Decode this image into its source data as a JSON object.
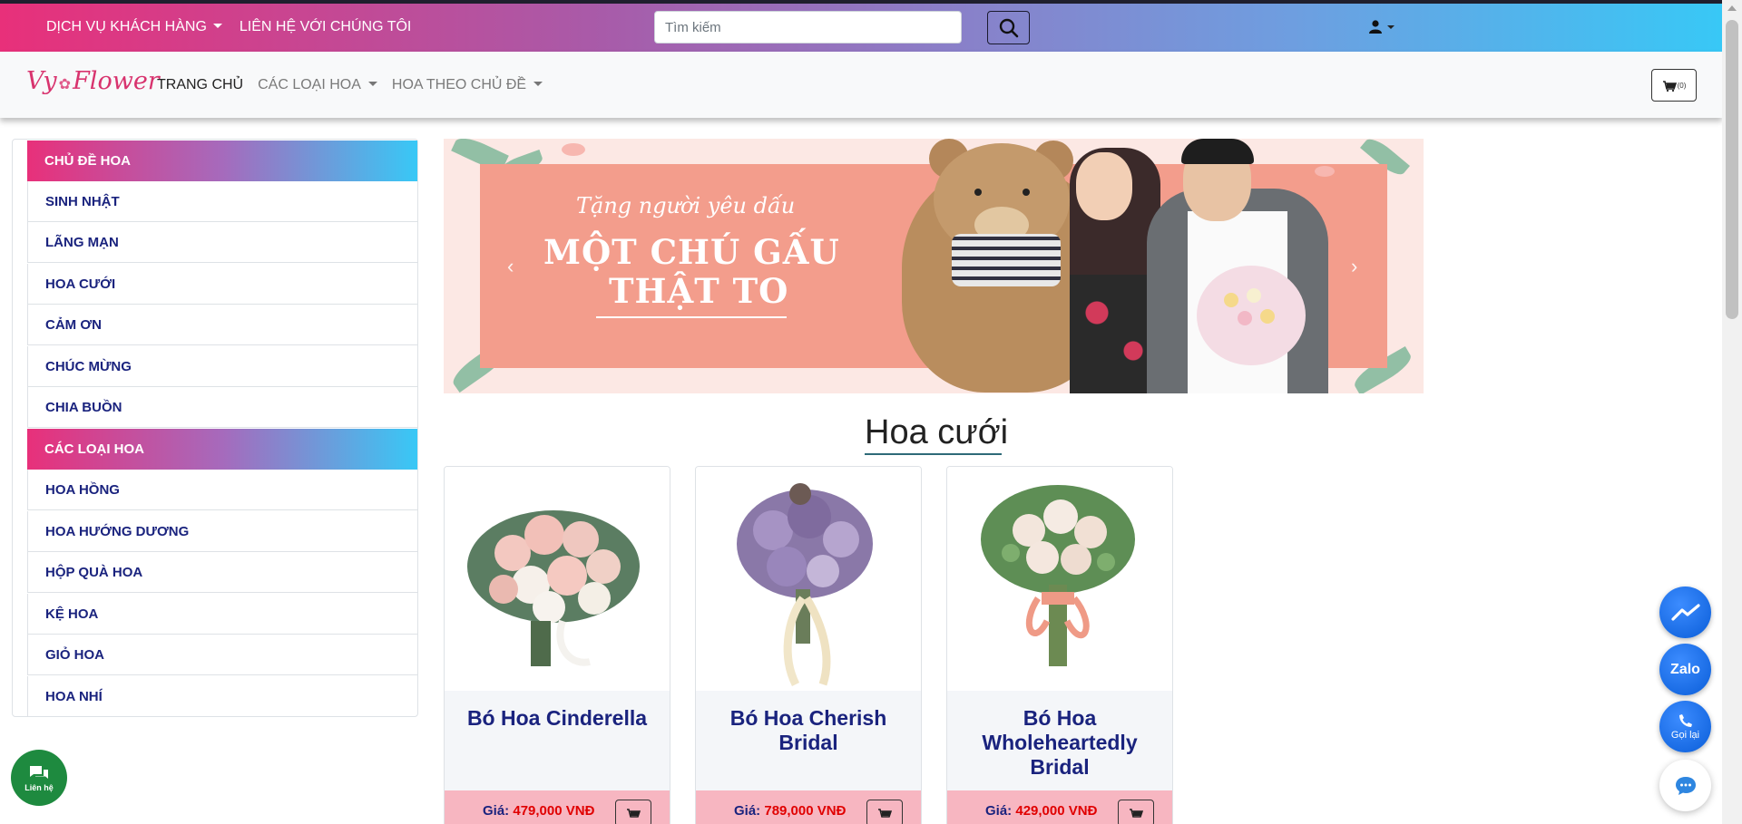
{
  "topbar": {
    "customer_service": "DỊCH VỤ KHÁCH HÀNG",
    "contact_us": "LIÊN HỆ VỚI CHÚNG TÔI",
    "search_placeholder": "Tìm kiếm",
    "colors": {
      "gradient_start": "#e8307a",
      "gradient_end": "#38c8f6"
    }
  },
  "navbar": {
    "logo_left": "Vy",
    "logo_right": "Flower",
    "home": "TRANG CHỦ",
    "flower_types": "CÁC LOẠI HOA",
    "flower_by_theme": "HOA THEO CHỦ ĐỀ",
    "cart_count": "(0)"
  },
  "sidebar": {
    "theme_header": "CHỦ ĐỀ HOA",
    "theme_items": [
      "SINH NHẬT",
      "LÃNG MẠN",
      "HOA CƯỚI",
      "CẢM ƠN",
      "CHÚC MỪNG",
      "CHIA BUỒN"
    ],
    "type_header": "CÁC LOẠI HOA",
    "type_items": [
      "HOA HỒNG",
      "HOA HƯỚNG DƯƠNG",
      "HỘP QUÀ HOA",
      "KỆ HOA",
      "GIỎ HOA",
      "HOA NHÍ"
    ]
  },
  "banner": {
    "line1": "Tặng người yêu dấu",
    "line2": "MỘT CHÚ GẤU",
    "line3": "THẬT TO"
  },
  "section": {
    "title": "Hoa cưới"
  },
  "products": [
    {
      "name": "Bó Hoa Cinderella",
      "price_label": "Giá:",
      "price": "479,000 VNĐ"
    },
    {
      "name": "Bó Hoa Cherish Bridal",
      "price_label": "Giá:",
      "price": "789,000 VNĐ"
    },
    {
      "name": "Bó Hoa Wholeheartedly Bridal",
      "price_label": "Giá:",
      "price": "429,000 VNĐ"
    }
  ],
  "floating": {
    "zalo": "Zalo",
    "call": "Gọi lại",
    "contact": "Liên hệ"
  },
  "icons": [
    "search-icon",
    "user-icon",
    "cart-icon",
    "messenger-icon",
    "phone-icon",
    "chat-icon",
    "chevron-left-icon",
    "chevron-right-icon"
  ]
}
